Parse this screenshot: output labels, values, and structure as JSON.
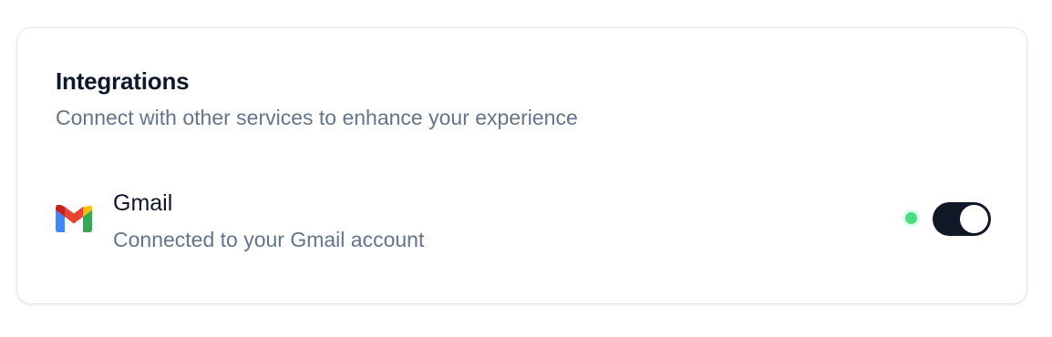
{
  "integrations": {
    "title": "Integrations",
    "subtitle": "Connect with other services to enhance your experience",
    "items": [
      {
        "name": "Gmail",
        "description": "Connected to your Gmail account",
        "icon": "gmail-icon",
        "status": "connected",
        "status_color": "#4ade80",
        "enabled": true,
        "toggle_color": "#111827"
      }
    ]
  }
}
